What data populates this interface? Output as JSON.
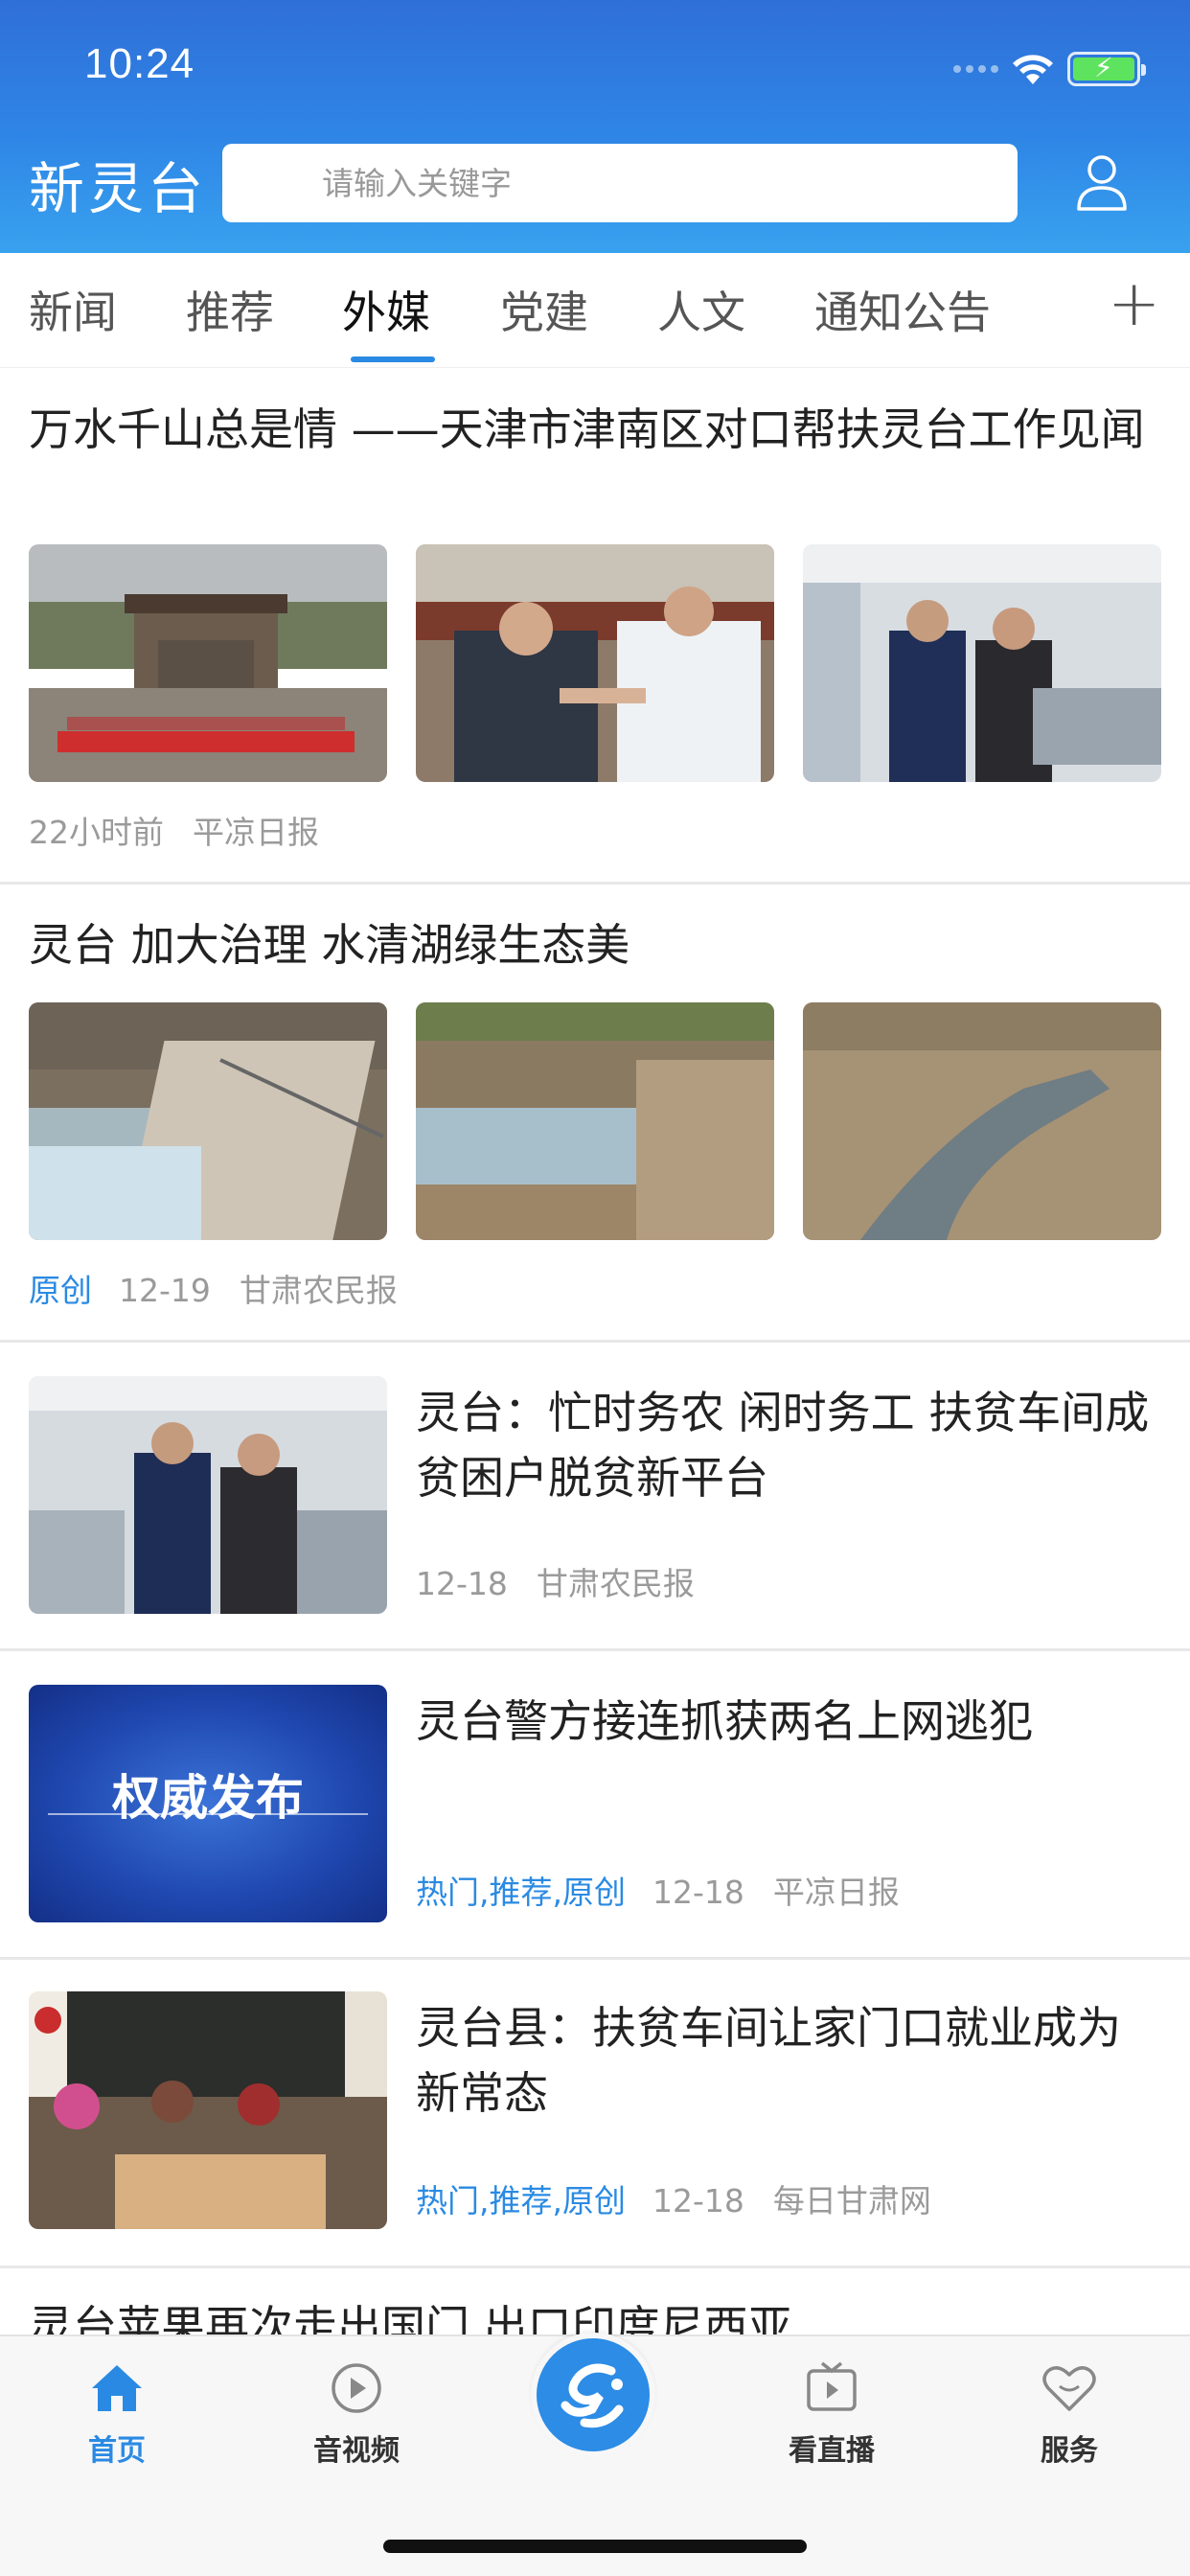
{
  "status_bar": {
    "time": "10:24"
  },
  "header": {
    "app_title": "新灵台",
    "search_placeholder": "请输入关键字"
  },
  "tabs": {
    "items": [
      "新闻",
      "推荐",
      "外媒",
      "党建",
      "人文",
      "通知公告"
    ],
    "active": "外媒",
    "add_label": "+"
  },
  "feed": [
    {
      "title": "万水千山总是情 ——天津市津南区对口帮扶灵台工作见闻",
      "time": "22小时前",
      "source": "平凉日报"
    },
    {
      "title": "灵台 加大治理 水清湖绿生态美",
      "tag": "原创",
      "time": "12-19",
      "source": "甘肃农民报"
    },
    {
      "title": "灵台：忙时务农 闲时务工 扶贫车间成贫困户脱贫新平台",
      "time": "12-18",
      "source": "甘肃农民报"
    },
    {
      "title": "灵台警方接连抓获两名上网逃犯",
      "tag": "热门,推荐,原创",
      "time": "12-18",
      "source": "平凉日报",
      "thumb_text": "权威发布"
    },
    {
      "title": "灵台县：扶贫车间让家门口就业成为新常态",
      "tag": "热门,推荐,原创",
      "time": "12-18",
      "source": "每日甘肃网"
    },
    {
      "title": "灵台苹果再次走出国门 出口印度尼西亚"
    }
  ],
  "bottom_nav": {
    "home": "首页",
    "video": "音视频",
    "live": "看直播",
    "service": "服务"
  },
  "colors": {
    "header_top": "#2f6fd8",
    "header_bottom": "#38a2ef",
    "accent": "#2a8ae3",
    "meta": "#9a9a9a"
  }
}
